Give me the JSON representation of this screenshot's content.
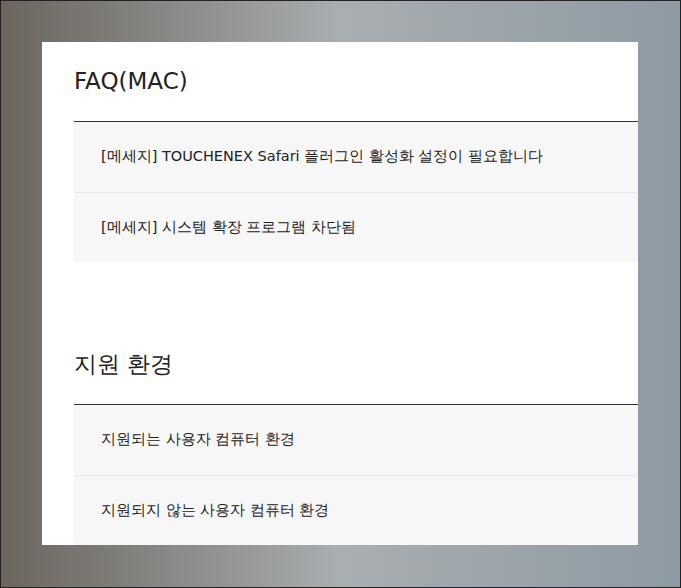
{
  "sections": [
    {
      "title": "FAQ(MAC)",
      "items": [
        "[메세지] TOUCHENEX Safari 플러그인 활성화 설정이 필요합니다",
        "[메세지] 시스템 확장 프로그램 차단됨"
      ]
    },
    {
      "title": "지원 환경",
      "items": [
        "지원되는 사용자 컴퓨터 환경",
        "지원되지 않는 사용자 컴퓨터 환경"
      ]
    }
  ]
}
